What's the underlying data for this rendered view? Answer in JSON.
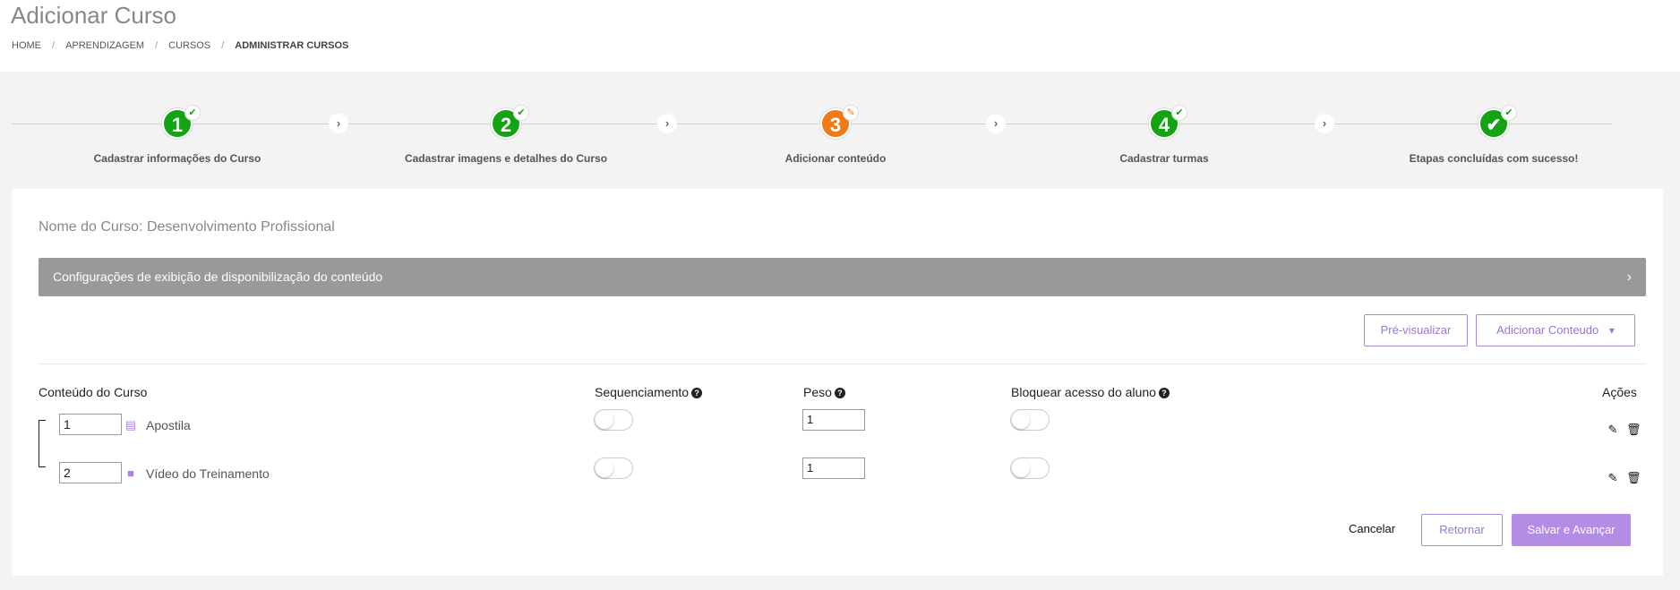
{
  "header": {
    "title": "Adicionar Curso",
    "breadcrumb": [
      "HOME",
      "APRENDIZAGEM",
      "CURSOS",
      "ADMINISTRAR CURSOS"
    ]
  },
  "stepper": {
    "steps": [
      {
        "number": "1",
        "label": "Cadastrar informações do Curso",
        "status": "done",
        "color": "#13a313"
      },
      {
        "number": "2",
        "label": "Cadastrar imagens e detalhes do Curso",
        "status": "done",
        "color": "#13a313"
      },
      {
        "number": "3",
        "label": "Adicionar conteúdo",
        "status": "current",
        "color": "#f07a17"
      },
      {
        "number": "4",
        "label": "Cadastrar turmas",
        "status": "done",
        "color": "#13a313"
      },
      {
        "number": "✔",
        "label": "Etapas concluídas com sucesso!",
        "status": "done",
        "color": "#13a313"
      }
    ]
  },
  "course": {
    "name_label": "Nome do Curso: Desenvolvimento Profissional"
  },
  "config_bar": {
    "label": "Configurações de exibição de disponibilização do conteúdo"
  },
  "toolbar": {
    "preview_label": "Pré-visualizar",
    "add_content_label": "Adicionar Conteudo"
  },
  "table": {
    "headers": {
      "content": "Conteúdo do Curso",
      "sequencing": "Sequenciamento",
      "weight": "Peso",
      "block_access": "Bloquear acesso do aluno",
      "actions": "Ações"
    },
    "rows": [
      {
        "order": "1",
        "icon": "document-icon",
        "title": "Apostila",
        "sequencing": false,
        "weight": "1",
        "block": false
      },
      {
        "order": "2",
        "icon": "video-icon",
        "title": "Vídeo do Treinamento",
        "sequencing": false,
        "weight": "1",
        "block": false
      }
    ]
  },
  "footer": {
    "cancel_label": "Cancelar",
    "back_label": "Retornar",
    "save_label": "Salvar e Avançar"
  },
  "colors": {
    "accent": "#b38de3",
    "accent_text": "#9b76d6",
    "step_done": "#13a313",
    "step_current": "#f07a17",
    "config_bar": "#999999"
  }
}
